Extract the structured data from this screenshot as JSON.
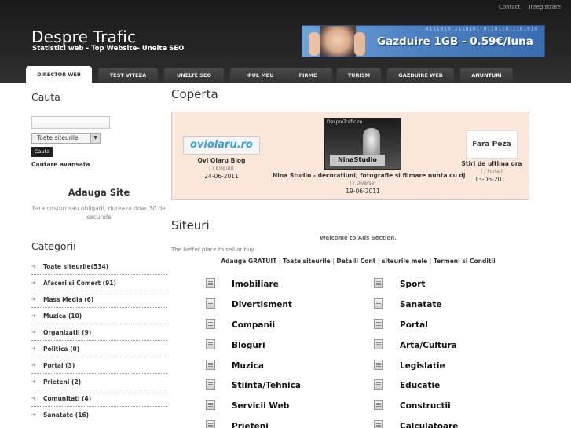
{
  "toplinks": [
    "Contact",
    "Inregistrare"
  ],
  "header": {
    "title": "Despre Trafic",
    "slogan": "Statistici web - Top Website- Unelte SEO"
  },
  "banner": {
    "text": "Gazduire 1GB - 0.59€/luna",
    "binary": "0111010 1110101 0110110 1101010"
  },
  "nav": [
    "DIRECTOR WEB",
    "TEST VITEZA",
    "UNELTE SEO",
    "IPUL MEU",
    "FIRME",
    "TURISM",
    "GAZDUIRE WEB",
    "ANUNTURI"
  ],
  "sidebar": {
    "search_title": "Cauta",
    "search_input_value": "",
    "select_value": "Toate siteurile",
    "search_button": "Cauta",
    "advanced_search": "Cautare avansata",
    "add_site_title": "Adauga Site",
    "add_site_desc": "Fara costuri sau obligatii, dureaza doar 30 de secunde",
    "categories_title": "Categorii",
    "categories": [
      "Toate siteurile(534)",
      "Afaceri si Comert (91)",
      "Mass Media (6)",
      "Muzica (10)",
      "Organizatii (9)",
      "Politica (0)",
      "Portal (3)",
      "Prieteni (2)",
      "Comunitati (4)",
      "Sanatate (16)"
    ]
  },
  "main": {
    "coperta_title": "Coperta",
    "featured": [
      {
        "logo_text": "oviolaru.ro",
        "name": "Ovi Olaru Blog",
        "category": "( / Bloguri)",
        "date": "24-06-2011"
      },
      {
        "logo_top": "DespreTrafic.ro",
        "logo_text": "NinaStudio",
        "name": "Nina Studio - decoratiuni, fotografie si filmare nunta cu dj",
        "category": "( / Diverse)",
        "date": "19-06-2011"
      },
      {
        "logo_text": "Fara Poza",
        "name": "Stiri de ultima ora",
        "category": "( / Portal)",
        "date": "13-06-2011"
      }
    ],
    "siteuri_title": "Siteuri",
    "welcome": "Welcome to Ads Section.",
    "better": "The better place to sell or buy",
    "ad_links": [
      "Adauga GRATUIT",
      "Toate siteurile",
      "Detalii Cont",
      "siteurile mele",
      "Termeni si Conditii"
    ],
    "ad_categories_left": [
      "Imobiliare",
      "Divertisment",
      "Companii",
      "Bloguri",
      "Muzica",
      "Stiinta/Tehnica",
      "Servicii Web",
      "Prieteni"
    ],
    "ad_categories_right": [
      "Sport",
      "Sanatate",
      "Portal",
      "Arta/Cultura",
      "Legislatie",
      "Educatie",
      "Constructii",
      "Calculatoare"
    ]
  }
}
